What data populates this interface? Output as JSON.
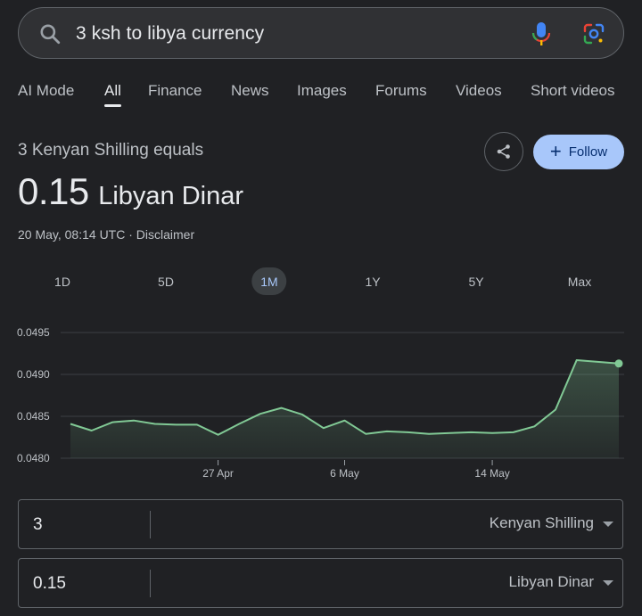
{
  "search": {
    "query": "3 ksh to libya currency"
  },
  "tabs": [
    "AI Mode",
    "All",
    "Finance",
    "News",
    "Images",
    "Forums",
    "Videos",
    "Short videos"
  ],
  "active_tab": "All",
  "result": {
    "subtitle": "3 Kenyan Shilling equals",
    "amount": "0.15",
    "currency": "Libyan Dinar",
    "meta": "20 May, 08:14 UTC · Disclaimer"
  },
  "actions": {
    "follow_label": "Follow"
  },
  "ranges": [
    "1D",
    "5D",
    "1M",
    "1Y",
    "5Y",
    "Max"
  ],
  "active_range": "1M",
  "colors": {
    "background": "#202124",
    "line": "#81c995",
    "accent": "#a8c7fa"
  },
  "chart_data": {
    "type": "area",
    "y_ticks": [
      "0.0495",
      "0.0490",
      "0.0485",
      "0.0480"
    ],
    "ylim": [
      0.048,
      0.0495
    ],
    "x_tick_labels": [
      {
        "label": "27 Apr",
        "index": 7
      },
      {
        "label": "6 May",
        "index": 13
      },
      {
        "label": "14 May",
        "index": 20
      }
    ],
    "values": [
      0.04841,
      0.04833,
      0.04843,
      0.04845,
      0.04841,
      0.0484,
      0.0484,
      0.04828,
      0.04841,
      0.04853,
      0.0486,
      0.04852,
      0.04836,
      0.04845,
      0.04829,
      0.04832,
      0.04831,
      0.04829,
      0.0483,
      0.04831,
      0.0483,
      0.04831,
      0.04838,
      0.04858,
      0.04917,
      0.04915,
      0.04913
    ],
    "grid": true
  },
  "converter": [
    {
      "value": "3",
      "unit": "Kenyan Shilling"
    },
    {
      "value": "0.15",
      "unit": "Libyan Dinar"
    }
  ]
}
